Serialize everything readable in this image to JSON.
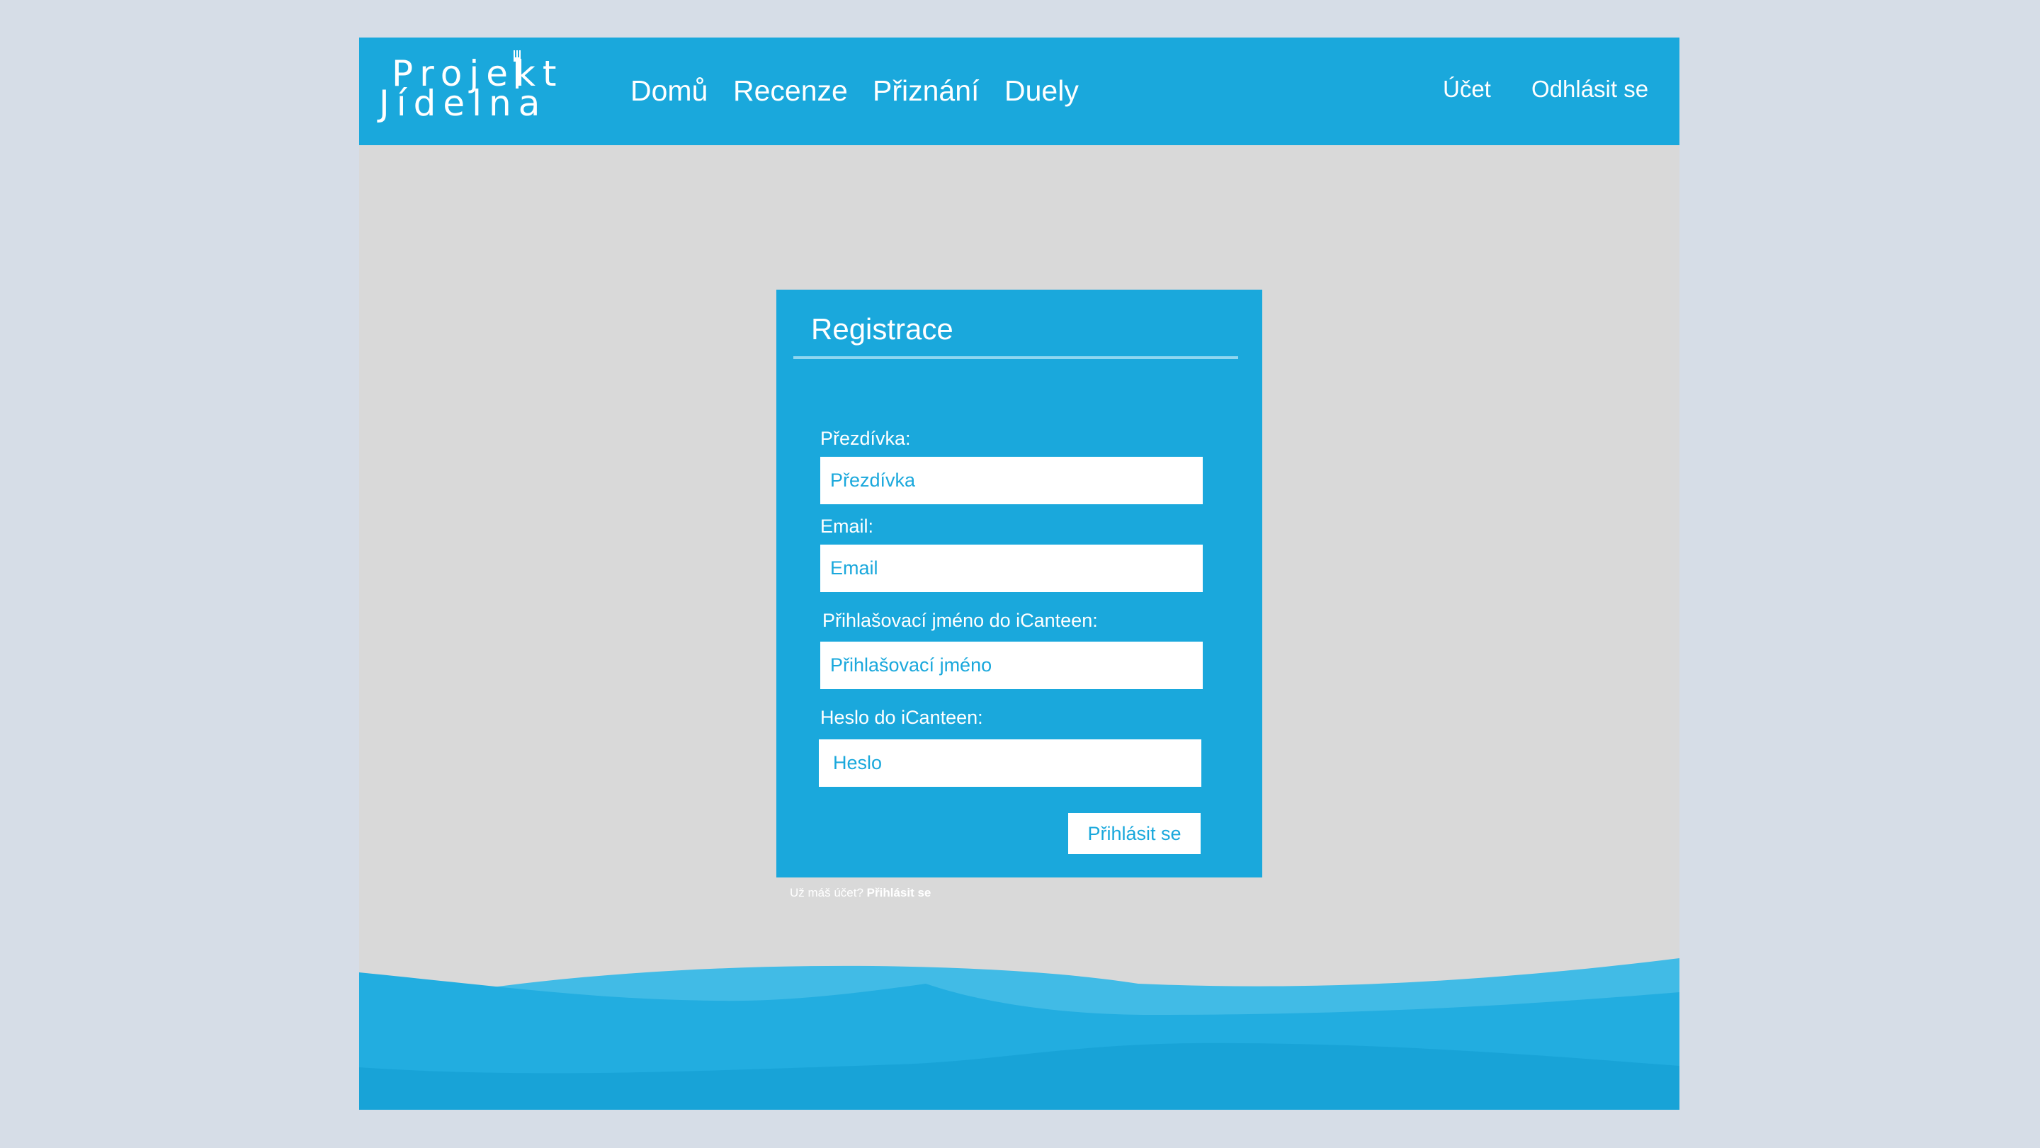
{
  "brand": {
    "line1": "Projekt",
    "line2": "Jídelna"
  },
  "nav": {
    "items": [
      {
        "label": "Domů"
      },
      {
        "label": "Recenze"
      },
      {
        "label": "Přiznání"
      },
      {
        "label": "Duely"
      }
    ],
    "account": "Účet",
    "logout": "Odhlásit se"
  },
  "form": {
    "title": "Registrace",
    "fields": [
      {
        "label": "Přezdívka:",
        "placeholder": "Přezdívka",
        "value": ""
      },
      {
        "label": "Email:",
        "placeholder": "Email",
        "value": ""
      },
      {
        "label": "Přihlašovací jméno do iCanteen:",
        "placeholder": "Přihlašovací jméno",
        "value": ""
      },
      {
        "label": "Heslo do iCanteen:",
        "placeholder": "Heslo",
        "value": ""
      }
    ],
    "submit_label": "Přihlásit se",
    "footer_prompt": "Už máš účet?",
    "footer_link": "Přihlásit se"
  },
  "colors": {
    "page_background": "#d6dde7",
    "content_background": "#d9d9d9",
    "primary": "#1aa8dc",
    "wave_light": "#41bbe6",
    "wave_mid": "#22ade0",
    "wave_dark": "#18a3d7"
  }
}
